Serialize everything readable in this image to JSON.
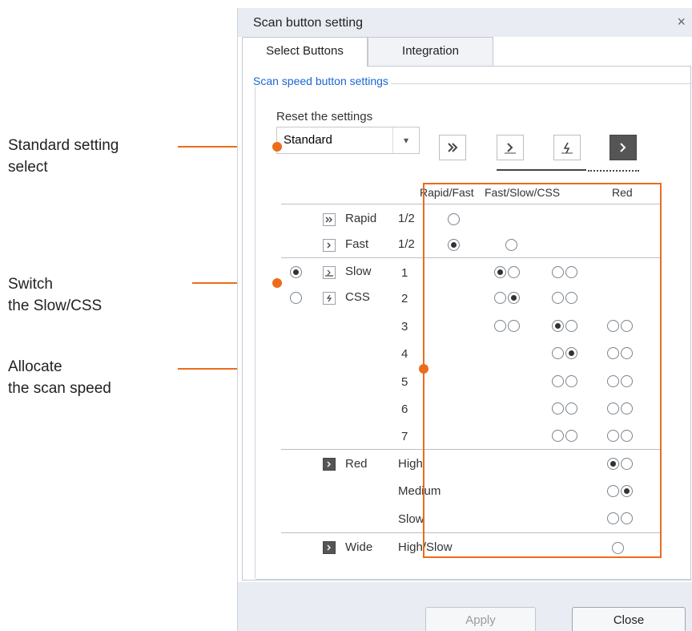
{
  "annotations": {
    "standard_select": [
      "Standard setting",
      "select"
    ],
    "switch_slow_css": [
      "Switch",
      "the Slow/CSS"
    ],
    "allocate_speed": [
      "Allocate",
      "the scan speed"
    ]
  },
  "dialog": {
    "title": "Scan button setting",
    "close_glyph": "×",
    "tabs": [
      "Select Buttons",
      "Integration"
    ],
    "group_title": "Scan speed button settings",
    "reset_label": "Reset the settings",
    "select_value": "Standard",
    "dropdown_glyph": "▾",
    "columns": [
      "Rapid/Fast",
      "Fast/Slow/CSS",
      "Red"
    ],
    "rows": {
      "rapid": {
        "name": "Rapid",
        "speed": "1/2"
      },
      "fast": {
        "name": "Fast",
        "speed": "1/2"
      },
      "slow": {
        "name": "Slow",
        "speed": "1"
      },
      "css": {
        "name": "CSS",
        "speed": "2"
      },
      "n3": "3",
      "n4": "4",
      "n5": "5",
      "n6": "6",
      "n7": "7",
      "red": {
        "name": "Red",
        "levels": [
          "High",
          "Medium",
          "Slow"
        ]
      },
      "wide": {
        "name": "Wide",
        "level": "High/Slow"
      }
    },
    "buttons": {
      "apply": "Apply",
      "close": "Close"
    }
  },
  "colors": {
    "accent": "#ec6c1c",
    "group_title": "#1a66d4"
  },
  "icons": [
    "rapid-icon",
    "fast-icon",
    "css-icon",
    "red-icon",
    "wide-icon",
    "close-icon",
    "chevron-down-icon"
  ]
}
